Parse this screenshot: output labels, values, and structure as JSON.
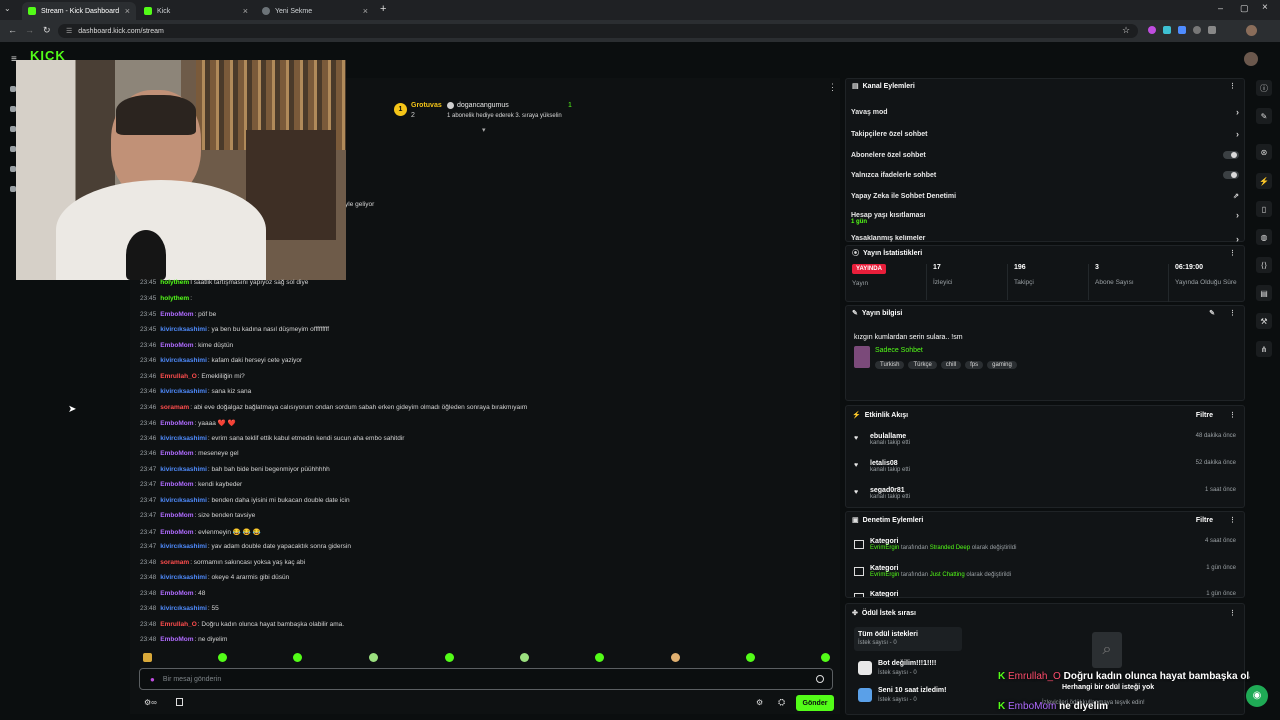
{
  "browser": {
    "tabs": [
      {
        "label": "Stream - Kick Dashboard"
      },
      {
        "label": "Kick"
      },
      {
        "label": "Yeni Sekme"
      }
    ],
    "url": "dashboard.kick.com/stream"
  },
  "kick": {
    "logo": "KICK",
    "accent": "#53fc18"
  },
  "pinned": {
    "gifter": "Grotuvas",
    "gifter_count": "2",
    "gifter2": "dogancangumus",
    "gifter2_count": "1",
    "gift_note": "1 abonelik hediye ederek 3. sıraya yükselin",
    "rank": "1"
  },
  "chat": {
    "partial_line": "yle geliyor",
    "partial_top": "I saatlik tartışmasını yapıyoz sağ sol diye",
    "partial_top_user": "holythem",
    "messages": [
      {
        "time": "23:45",
        "user": "holythem",
        "color": "#53fc18",
        "text": ": "
      },
      {
        "time": "23:45",
        "user": "EmboMom",
        "color": "#b06bff",
        "text": ": pöf be"
      },
      {
        "time": "23:45",
        "user": "kivircıksashimi",
        "color": "#4f8cff",
        "text": ": ya ben bu kadına nasıl düşmeyim offfffffff"
      },
      {
        "time": "23:46",
        "user": "EmboMom",
        "color": "#b06bff",
        "text": ": kime düştün"
      },
      {
        "time": "23:46",
        "user": "kivircıksashimi",
        "color": "#4f8cff",
        "text": ": kafam daki herseyi cete yaziyor"
      },
      {
        "time": "23:46",
        "user": "Emrullah_O",
        "color": "#ff4d4d",
        "text": ": Emekliliğin mi?"
      },
      {
        "time": "23:46",
        "user": "kivircıksashimi",
        "color": "#4f8cff",
        "text": ": sana kiz sana"
      },
      {
        "time": "23:46",
        "user": "soramam",
        "color": "#ff4d4d",
        "text": ": abi eve doğalgaz bağlatmaya calısıyorum ondan sordum sabah erken gideyim olmadı öğleden sonraya bırakmıyaım"
      },
      {
        "time": "23:46",
        "user": "EmboMom",
        "color": "#b06bff",
        "text": ": yaaaa ❤️ ❤️"
      },
      {
        "time": "23:46",
        "user": "kivircıksashimi",
        "color": "#4f8cff",
        "text": ": evrim sana teklif ettik kabul etmedin kendi sucun aha embo sahitdir"
      },
      {
        "time": "23:46",
        "user": "EmboMom",
        "color": "#b06bff",
        "text": ": meseneye gel"
      },
      {
        "time": "23:47",
        "user": "kivircıksashimi",
        "color": "#4f8cff",
        "text": ": bah bah bide beni begenmiyor püühhhhh"
      },
      {
        "time": "23:47",
        "user": "EmboMom",
        "color": "#b06bff",
        "text": ": kendi kaybeder"
      },
      {
        "time": "23:47",
        "user": "kivircıksashimi",
        "color": "#4f8cff",
        "text": ": benden daha iyisini mi bukacan double date icin"
      },
      {
        "time": "23:47",
        "user": "EmboMom",
        "color": "#b06bff",
        "text": ": size benden tavsiye"
      },
      {
        "time": "23:47",
        "user": "EmboMom",
        "color": "#b06bff",
        "text": ": evlenmeyin 😂 😂 😂"
      },
      {
        "time": "23:47",
        "user": "kivircıksashimi",
        "color": "#4f8cff",
        "text": ": yav adam double date yapacaktık sonra gidersin"
      },
      {
        "time": "23:48",
        "user": "soramam",
        "color": "#ff4d4d",
        "text": ": sormamın sakıncası yoksa yaş kaç abi"
      },
      {
        "time": "23:48",
        "user": "kivircıksashimi",
        "color": "#4f8cff",
        "text": ": okeye 4 ararmis gibi düsün"
      },
      {
        "time": "23:48",
        "user": "EmboMom",
        "color": "#b06bff",
        "text": ": 48"
      },
      {
        "time": "23:48",
        "user": "kivircıksashimi",
        "color": "#4f8cff",
        "text": ": 55"
      },
      {
        "time": "23:48",
        "user": "Emrullah_O",
        "color": "#ff4d4d",
        "text": ": Doğru kadın olunca hayat bambaşka olabilir ama."
      },
      {
        "time": "23:48",
        "user": "EmboMom",
        "color": "#b06bff",
        "text": ": ne diyelim"
      }
    ],
    "input_placeholder": "Bir mesaj gönderin",
    "send_label": "Gönder"
  },
  "channel_actions": {
    "title": "Kanal Eylemleri",
    "rows": [
      {
        "label": "Yavaş mod"
      },
      {
        "label": "Takipçilere özel sohbet"
      },
      {
        "label": "Abonelere özel sohbet"
      },
      {
        "label": "Yalnızca ifadelerle sohbet"
      },
      {
        "label": "Yapay Zeka ile Sohbet Denetimi"
      },
      {
        "label": "Hesap yaşı kısıtlaması",
        "sub": "1 gün"
      },
      {
        "label": "Yasaklanmış kelimeler"
      }
    ]
  },
  "stream_stats": {
    "title": "Yayın İstatistikleri",
    "live_badge": "YAYINDA",
    "live_label": "Yayın",
    "stats": [
      {
        "value": "17",
        "label": "İzleyici"
      },
      {
        "value": "196",
        "label": "Takipçi"
      },
      {
        "value": "3",
        "label": "Abone Sayısı"
      },
      {
        "value": "06:19:00",
        "label": "Yayında Olduğu Süre"
      }
    ]
  },
  "stream_info": {
    "title": "Yayın bilgisi",
    "stream_title": "kızgın kumlardan serin sulara.. !sm",
    "category": "Sadece Sohbet",
    "tags": [
      "Turkish",
      "Türkçe",
      "chill",
      "fps",
      "gaming"
    ]
  },
  "activity": {
    "title": "Etkinlik Akışı",
    "filter": "Filtre",
    "items": [
      {
        "name": "ebulallame",
        "sub": "kanalı takip etti",
        "time": "48 dakika önce"
      },
      {
        "name": "letalis08",
        "sub": "kanalı takip etti",
        "time": "52 dakika önce"
      },
      {
        "name": "segad0r81",
        "sub": "kanalı takip etti",
        "time": "1 saat önce"
      }
    ]
  },
  "moderation": {
    "title": "Denetim Eylemleri",
    "filter": "Filtre",
    "items": [
      {
        "name": "Kategori",
        "who": "EvrimErgin",
        "mid": " tarafından ",
        "cat": "Stranded Deep",
        "end": " olarak değiştirildi",
        "time": "4 saat önce"
      },
      {
        "name": "Kategori",
        "who": "EvrimErgin",
        "mid": " tarafından ",
        "cat": "Just Chatting",
        "end": " olarak değiştirildi",
        "time": "1 gün önce"
      },
      {
        "name": "Kategori",
        "who": "",
        "mid": "",
        "cat": "",
        "end": "",
        "time": "1 gün önce"
      }
    ]
  },
  "rewards": {
    "title": "Ödül İstek sırası",
    "all": "Tüm ödül istekleri",
    "all_sub": "İstek sayısı - 0",
    "items": [
      {
        "name": "Bot değilim!!!1!!!!",
        "sub": "İstek sayısı - 0"
      },
      {
        "name": "Seni 10 saat izledim!",
        "sub": "İstek sayısı - 0"
      }
    ],
    "empty": "Herhangi bir ödül isteği yok",
    "empty_sub": "İzleyicileri ödül kullanmaya teşvik edin!"
  },
  "overlay": {
    "line1_user": "Emrullah_O",
    "line1_text": "Doğru kadın olunca hayat bambaşka olabilir ama.",
    "line2_user": "EmboMom",
    "line2_text": "ne diyelim"
  }
}
